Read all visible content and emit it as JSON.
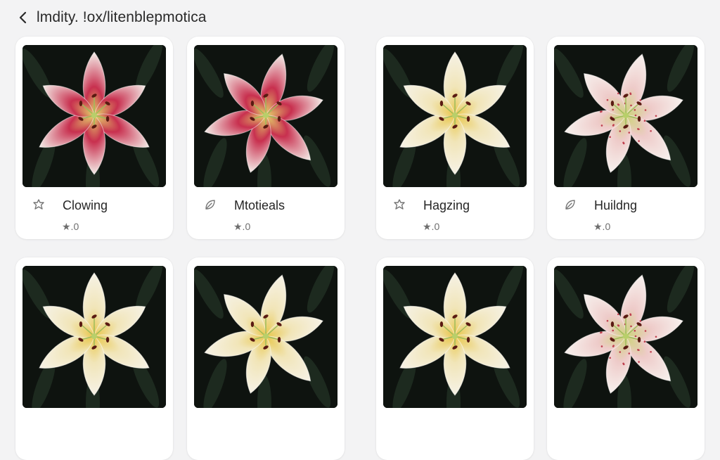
{
  "header": {
    "back_icon": "chevron-left-icon",
    "title": "lmdity. !ox/litenblepmotica"
  },
  "cards": [
    {
      "name": "Clowing",
      "rating": "★.0",
      "icon": "flower-outline-icon",
      "flower": "pink"
    },
    {
      "name": "Mtotieals",
      "rating": "★.0",
      "icon": "leaf-icon",
      "flower": "pink"
    },
    {
      "name": "Hagzing",
      "rating": "★.0",
      "icon": "flower-outline-icon",
      "flower": "white"
    },
    {
      "name": "Huildng",
      "rating": "★.0",
      "icon": "leaf-icon",
      "flower": "speckled"
    },
    {
      "name": "",
      "rating": "",
      "icon": "",
      "flower": "white"
    },
    {
      "name": "",
      "rating": "",
      "icon": "",
      "flower": "white"
    },
    {
      "name": "",
      "rating": "",
      "icon": "",
      "flower": "white"
    },
    {
      "name": "",
      "rating": "",
      "icon": "",
      "flower": "speckled"
    }
  ],
  "colors": {
    "background": "#f3f3f4",
    "card": "#ffffff",
    "photo_background": "#0e130f",
    "pink_petal": "#c8304f",
    "white_petal": "#f6f2e6",
    "petal_yellow": "#e8c64a"
  }
}
